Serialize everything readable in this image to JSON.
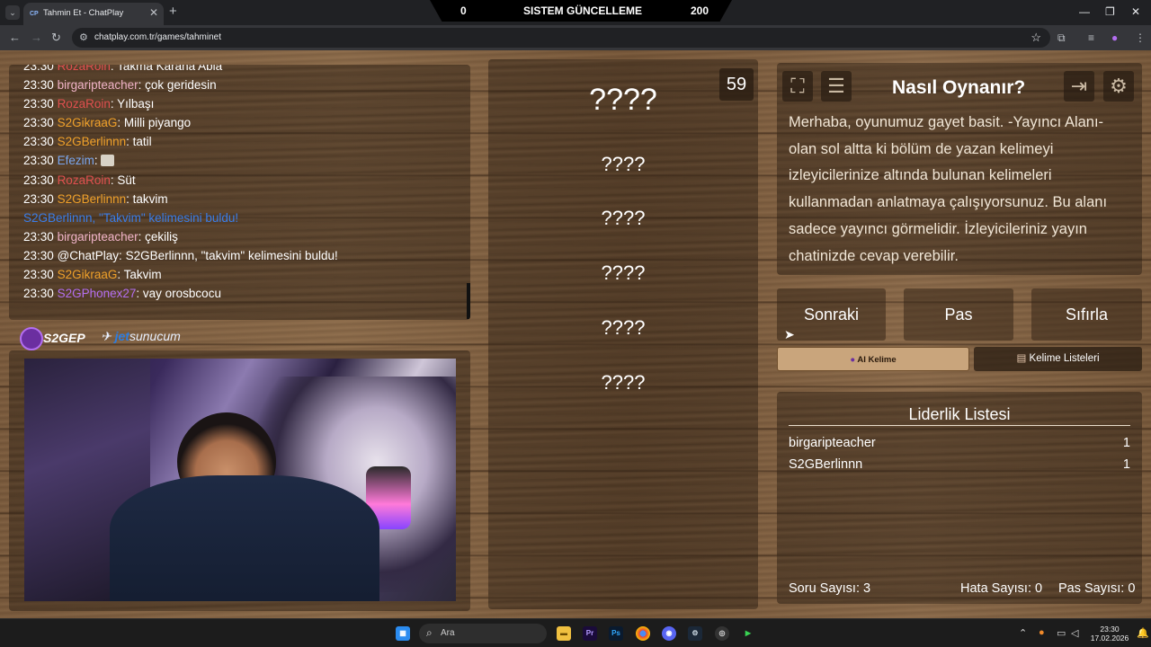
{
  "browser": {
    "tab_title": "Tahmin Et - ChatPlay",
    "tab_favicon": "CP",
    "url": "chatplay.com.tr/games/tahminet"
  },
  "banner": {
    "left_value": "0",
    "title": "SISTEM GÜNCELLEME",
    "right_value": "200"
  },
  "chat": {
    "partial_top": {
      "time": "23:30",
      "user": "RozaRoin",
      "user_color": "#e0504f",
      "text": "Takma Karana Abla"
    },
    "messages": [
      {
        "time": "23:30",
        "user": "birgaripteacher",
        "user_color": "#f0b3c8",
        "text": "çok geridesin"
      },
      {
        "time": "23:30",
        "user": "RozaRoin",
        "user_color": "#e0504f",
        "text": "Yılbaşı"
      },
      {
        "time": "23:30",
        "user": "S2GikraaG",
        "user_color": "#f0a12a",
        "text": "Milli piyango"
      },
      {
        "time": "23:30",
        "user": "S2GBerlinnn",
        "user_color": "#f0a12a",
        "text": "tatil"
      },
      {
        "time": "23:30",
        "user": "Efezim",
        "user_color": "#7aa7f0",
        "text": ""
      },
      {
        "time": "23:30",
        "user": "RozaRoin",
        "user_color": "#e0504f",
        "text": "Süt"
      },
      {
        "time": "23:30",
        "user": "S2GBerlinnn",
        "user_color": "#f0a12a",
        "text": "takvim"
      },
      {
        "time": "",
        "user": "S2GBerlinnn, \"Takvim\" kelimesini buldu!",
        "user_color": "#3a7de8",
        "text": ""
      },
      {
        "time": "23:30",
        "user": "birgaripteacher",
        "user_color": "#f0b3c8",
        "text": "çekiliş"
      },
      {
        "time": "23:30",
        "user": "@ChatPlay",
        "user_color": "#ffffff",
        "text": "S2GBerlinnn, \"takvim\" kelimesini buldu!"
      },
      {
        "time": "23:30",
        "user": "S2GikraaG",
        "user_color": "#f0a12a",
        "text": "Takvim"
      },
      {
        "time": "23:30",
        "user": "S2GPhonex27",
        "user_color": "#b36ef0",
        "text": "vay orosbcocu"
      }
    ]
  },
  "logos": {
    "s2gep": "S2GEP",
    "jet_prefix": "jet",
    "jet_suffix": "sunucum"
  },
  "game": {
    "timer": "59",
    "words": [
      "????",
      "????",
      "????",
      "????",
      "????",
      "????"
    ]
  },
  "info": {
    "title": "Nasıl Oynanır?",
    "text": "Merhaba, oyunumuz gayet basit. -Yayıncı Alanı- olan sol altta ki bölüm de yazan kelimeyi izleyicilerinize altında bulunan kelimeleri kullanmadan anlatmaya çalışıyorsunuz. Bu alanı sadece yayıncı görmelidir. İzleyicileriniz yayın chatinizde cevap verebilir."
  },
  "actions": {
    "next": "Sonraki",
    "pass": "Pas",
    "reset": "Sıfırla",
    "ai_word": "AI Kelime",
    "word_lists": "Kelime Listeleri"
  },
  "leaderboard": {
    "title": "Liderlik Listesi",
    "rows": [
      {
        "name": "birgaripteacher",
        "score": "1"
      },
      {
        "name": "S2GBerlinnn",
        "score": "1"
      }
    ],
    "question_count_label": "Soru Sayısı:",
    "question_count": "3",
    "error_count_label": "Hata Sayısı:",
    "error_count": "0",
    "pass_count_label": "Pas Sayısı:",
    "pass_count": "0"
  },
  "taskbar": {
    "search_placeholder": "Ara",
    "time": "23:30",
    "date": "17.02.2026"
  }
}
